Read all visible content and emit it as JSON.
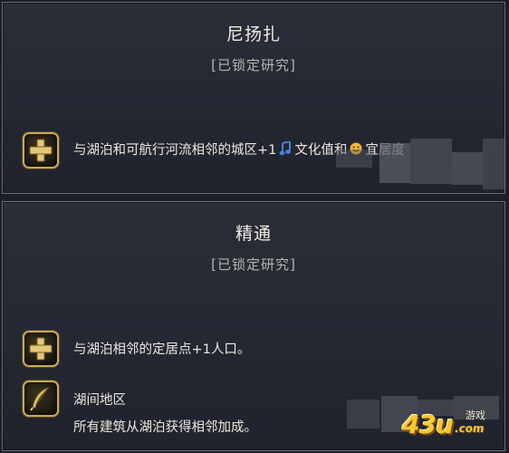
{
  "cards": [
    {
      "title": "尼扬扎",
      "status": "[已锁定研究]",
      "effects": [
        {
          "icon": "plus-icon",
          "text_before": "与湖泊和可航行河流相邻的城区+1",
          "culture_label": "文化值和",
          "amenity_label": "宜居度"
        }
      ]
    },
    {
      "title": "精通",
      "status": "[已锁定研究]",
      "effects": [
        {
          "icon": "plus-icon",
          "text": "与湖泊相邻的定居点+1人口。"
        },
        {
          "icon": "quill-icon",
          "name": "湖间地区",
          "description": "所有建筑从湖泊获得相邻加成。"
        }
      ]
    }
  ],
  "watermark": {
    "number": "43u",
    "domain": ".com",
    "game_label": "游戏"
  },
  "colors": {
    "gold_frame": "#c9a85a",
    "text": "#ece8de",
    "status_text": "#b9b5ad",
    "culture_icon": "#4a7fe0",
    "amenity_icon": "#f2b63a"
  }
}
